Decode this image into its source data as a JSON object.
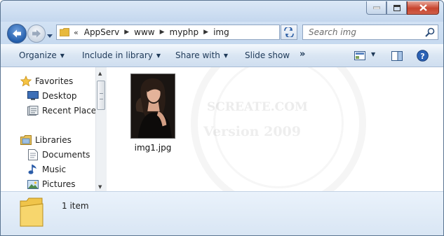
{
  "titlebar": {
    "buttons": {
      "minimize": "minimize-icon",
      "maximize": "maximize-icon",
      "close": "close-icon"
    }
  },
  "address": {
    "overflow_glyph": "«",
    "crumbs": [
      "AppServ",
      "www",
      "myphp",
      "img"
    ],
    "separator_glyph": "▶"
  },
  "search": {
    "placeholder": "Search img"
  },
  "commandbar": {
    "organize": "Organize",
    "include_in_library": "Include in library",
    "share_with": "Share with",
    "slide_show": "Slide show",
    "more": "»"
  },
  "nav": {
    "favorites": {
      "label": "Favorites",
      "items": [
        "Desktop",
        "Recent Places"
      ]
    },
    "libraries": {
      "label": "Libraries",
      "items": [
        "Documents",
        "Music",
        "Pictures"
      ]
    }
  },
  "content": {
    "files": [
      {
        "name": "img1.jpg",
        "type": "jpg-thumbnail"
      }
    ],
    "watermark": {
      "line1": "SCREATE.COM",
      "line2": "Version 2009"
    }
  },
  "details": {
    "item_count": "1 item"
  },
  "colors": {
    "accent": "#1f5aa8",
    "close_button": "#c7442e",
    "folder": "#e8b93c"
  }
}
